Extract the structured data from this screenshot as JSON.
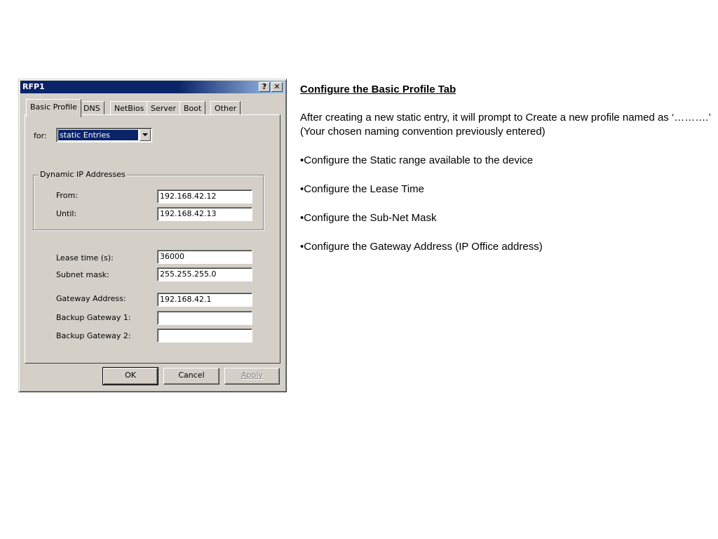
{
  "dialog": {
    "title": "RFP1",
    "help_button": "?",
    "close_button": "✕",
    "tabs": [
      {
        "label": "Basic Profile",
        "active": true
      },
      {
        "label": "DNS"
      },
      {
        "label": "NetBios"
      },
      {
        "label": "Server"
      },
      {
        "label": "Boot"
      },
      {
        "label": "Other"
      }
    ],
    "for_label": "for:",
    "for_value": "static Entries",
    "group_title": "Dynamic IP Addresses",
    "from_label": "From:",
    "from_value": "192.168.42.12",
    "until_label": "Until:",
    "until_value": "192.168.42.13",
    "lease_label": "Lease time (s):",
    "lease_value": "36000",
    "subnet_label": "Subnet mask:",
    "subnet_value": "255.255.255.0",
    "gateway_label": "Gateway Address:",
    "gateway_value": "192.168.42.1",
    "backup1_label": "Backup Gateway 1:",
    "backup1_value": "",
    "backup2_label": "Backup Gateway 2:",
    "backup2_value": "",
    "ok_label": "OK",
    "cancel_label": "Cancel",
    "apply_label": "Apply"
  },
  "slide": {
    "heading": "Configure the Basic Profile Tab",
    "intro": "After creating a new static entry, it will prompt to Create a new profile named as ‘……….’ (Your chosen naming convention previously entered)",
    "bullets": [
      "•Configure the Static range available to the device",
      "•Configure the Lease Time",
      "•Configure the Sub-Net Mask",
      "•Configure the Gateway Address (IP Office address)"
    ]
  },
  "colors": {
    "titlebar": "#0a246a",
    "dialog_face": "#d4d0c8",
    "selection": "#0a246a"
  }
}
